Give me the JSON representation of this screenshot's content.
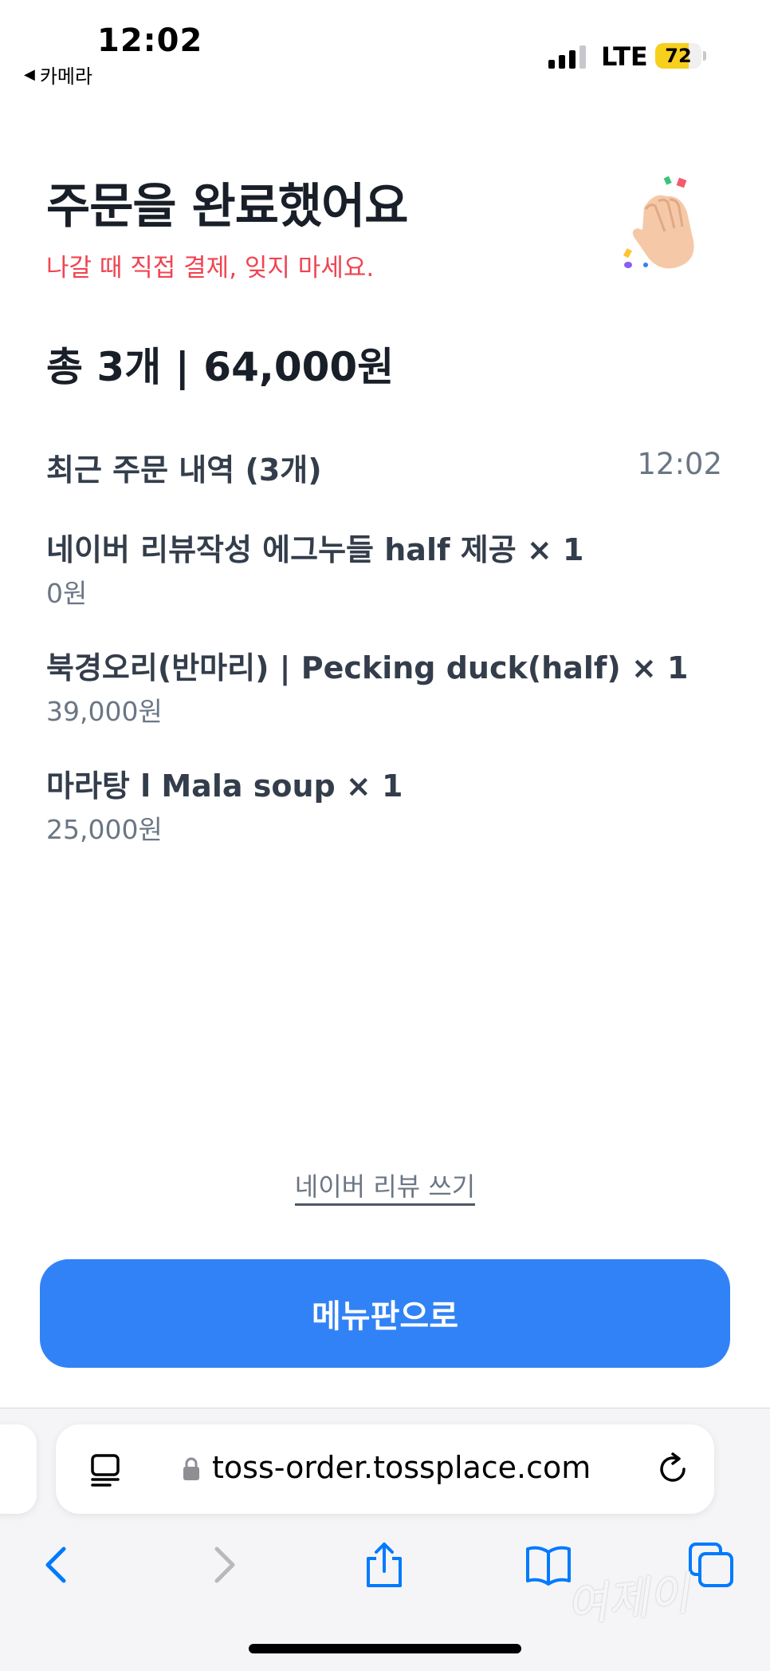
{
  "status_bar": {
    "time": "12:02",
    "back_app": "카메라",
    "network": "LTE",
    "battery": "72",
    "battery_level": 0.72
  },
  "header": {
    "title": "주문을 완료했어요",
    "subtitle": "나갈 때 직접 결제, 잊지 마세요."
  },
  "summary": {
    "total": "총 3개 | 64,000원"
  },
  "recent_orders": {
    "title": "최근 주문 내역 (3개)",
    "time": "12:02",
    "items": [
      {
        "name": "네이버 리뷰작성 에그누들 half 제공 × 1",
        "price": "0원"
      },
      {
        "name": "북경오리(반마리) | Pecking duck(half) × 1",
        "price": "39,000원"
      },
      {
        "name": "마라탕 l Mala soup × 1",
        "price": "25,000원"
      }
    ]
  },
  "actions": {
    "review_link": "네이버 리뷰 쓰기",
    "menu_button": "메뉴판으로"
  },
  "browser": {
    "url": "toss-order.tossplace.com"
  },
  "watermark": "여제이",
  "colors": {
    "accent": "#3182f6",
    "warning": "#f04452",
    "title": "#191f28",
    "text": "#333d4b",
    "secondary": "#6b7684"
  }
}
